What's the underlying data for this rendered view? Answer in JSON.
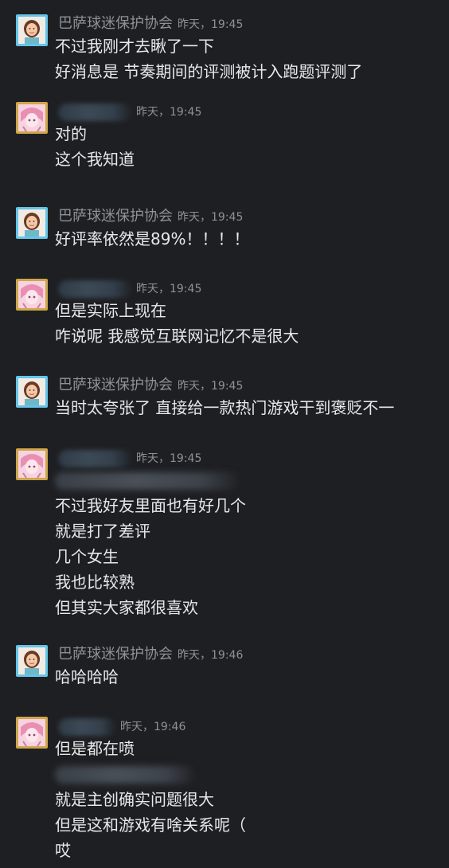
{
  "messages": [
    {
      "sender": "巴萨球迷保护协会",
      "time": "昨天，19:45",
      "avatar": "woman-portrait-avatar",
      "lines": [
        "不过我刚才去瞅了一下",
        "好消息是 节奏期间的评测被计入跑题评测了"
      ]
    },
    {
      "sender": "",
      "time": "昨天，19:45",
      "avatar": "anime-girl-avatar",
      "lines": [
        "对的",
        "这个我知道"
      ]
    },
    {
      "sender": "巴萨球迷保护协会",
      "time": "昨天，19:45",
      "avatar": "woman-portrait-avatar",
      "lines": [
        "好评率依然是89%！！！！"
      ]
    },
    {
      "sender": "",
      "time": "昨天，19:45",
      "avatar": "anime-girl-avatar",
      "lines": [
        "但是实际上现在",
        "咋说呢 我感觉互联网记忆不是很大"
      ]
    },
    {
      "sender": "巴萨球迷保护协会",
      "time": "昨天，19:45",
      "avatar": "woman-portrait-avatar",
      "lines": [
        "当时太夸张了 直接给一款热门游戏干到褒贬不一"
      ]
    },
    {
      "sender": "",
      "time": "昨天，19:45",
      "avatar": "anime-girl-avatar",
      "lines": [
        "不过我好友里面也有好几个",
        "就是打了差评",
        "几个女生",
        "我也比较熟",
        "但其实大家都很喜欢"
      ]
    },
    {
      "sender": "巴萨球迷保护协会",
      "time": "昨天，19:46",
      "avatar": "woman-portrait-avatar",
      "lines": [
        "哈哈哈哈"
      ]
    },
    {
      "sender": "",
      "time": "昨天，19:46",
      "avatar": "anime-girl-avatar",
      "lines": [
        "但是都在喷",
        "就是主创确实问题很大",
        "但是这和游戏有啥关系呢（",
        "哎"
      ]
    }
  ],
  "colors": {
    "background": "#1e1f22",
    "text": "#e6e8ea",
    "meta": "#8d9298",
    "avatar_border_blue": "#63c5e8",
    "avatar_border_gold": "#cfa64a"
  }
}
